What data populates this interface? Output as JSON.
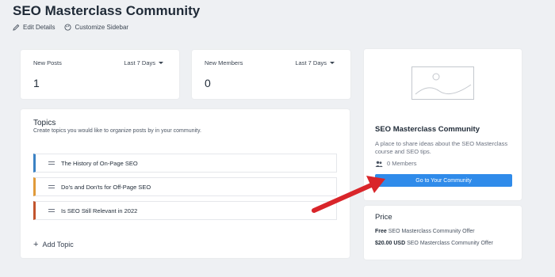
{
  "header": {
    "title": "SEO Masterclass Community",
    "edit_label": "Edit Details",
    "customize_label": "Customize Sidebar"
  },
  "stats": [
    {
      "label": "New Posts",
      "period": "Last 7 Days",
      "value": "1"
    },
    {
      "label": "New Members",
      "period": "Last 7 Days",
      "value": "0"
    }
  ],
  "topics": {
    "title": "Topics",
    "description": "Create topics you would like to organize posts by in your community.",
    "items": [
      {
        "label": "The History of On-Page SEO",
        "color": "#3b82c4"
      },
      {
        "label": "Do's and Don'ts for Off-Page SEO",
        "color": "#e09a3a"
      },
      {
        "label": "Is SEO Still Relevant in 2022",
        "color": "#c2542d"
      }
    ],
    "add_label": "Add Topic"
  },
  "community": {
    "title": "SEO Masterclass Community",
    "description": "A place to share ideas about the SEO Masterclass course and SEO tips.",
    "members": "0 Members",
    "cta_label": "Go to Your Community",
    "accent": "#2f8bea"
  },
  "price": {
    "title": "Price",
    "offers": [
      {
        "amount": "Free",
        "name": "SEO Masterclass Community Offer"
      },
      {
        "amount": "$20.00 USD",
        "name": "SEO Masterclass Community Offer"
      }
    ]
  },
  "annotation": {
    "arrow_color": "#d9252a"
  }
}
